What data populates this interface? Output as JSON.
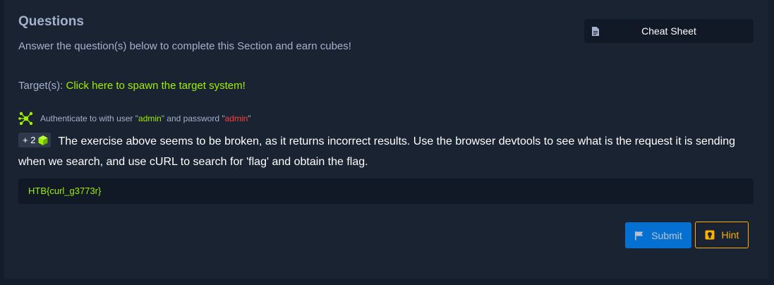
{
  "section": {
    "title": "Questions",
    "subtitle": "Answer the question(s) below to complete this Section and earn cubes!"
  },
  "cheat_sheet": {
    "label": "Cheat Sheet",
    "icon": "document-icon"
  },
  "target": {
    "prefix": "Target(s): ",
    "link_text": "Click here to spawn the target system!"
  },
  "auth": {
    "icon": "network-icon",
    "text_before": "Authenticate to with user \"",
    "user": "admin",
    "text_middle": "\" and password \"",
    "password": "admin",
    "text_after": "\""
  },
  "question": {
    "badge_label": "+ 2",
    "badge_icon": "cube-icon",
    "text": "The exercise above seems to be broken, as it returns incorrect results. Use the browser devtools to see what is the request it is sending when we search, and use cURL to search for 'flag' and obtain the flag."
  },
  "answer": {
    "value": "HTB{curl_g3773r}"
  },
  "buttons": {
    "submit_label": "Submit",
    "submit_icon": "flag-icon",
    "hint_label": "Hint",
    "hint_icon": "lightbulb-icon"
  },
  "colors": {
    "background": "#141d2b",
    "panel": "#1a2332",
    "accent_green": "#9fef00",
    "accent_red": "#ff3e3e",
    "submit_blue": "#0086ff",
    "hint_orange": "#ffaf00",
    "muted_text": "#a4b1cd"
  }
}
